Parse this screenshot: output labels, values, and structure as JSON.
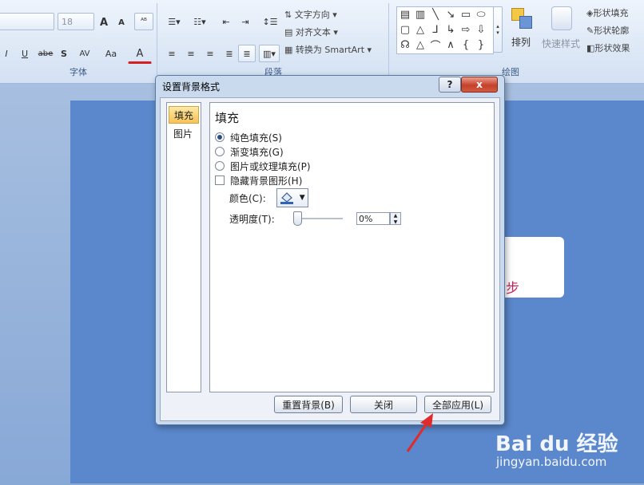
{
  "ribbon": {
    "font_size_value": "18",
    "font_group_label": "字体",
    "paragraph_group_label": "段落",
    "drawing_group_label": "绘图",
    "text_direction": "文字方向",
    "align_text": "对齐文本",
    "convert_smartart": "转换为 SmartArt",
    "arrange": "排列",
    "quick_styles": "快速样式",
    "shape_fill": "形状填充",
    "shape_outline": "形状轮廓",
    "shape_effects": "形状效果",
    "btn_grow": "A",
    "btn_shrink": "A",
    "btn_italic": "I",
    "btn_underline": "U",
    "btn_strike": "abe",
    "btn_shadow": "S",
    "btn_spacing": "AV",
    "btn_case": "Aa",
    "btn_color": "A"
  },
  "slide": {
    "visible_char": "步"
  },
  "dialog": {
    "title": "设置背景格式",
    "help_glyph": "?",
    "close_glyph": "x",
    "nav": [
      {
        "label": "填充",
        "active": true
      },
      {
        "label": "图片",
        "active": false
      }
    ],
    "panel_title": "填充",
    "options": [
      {
        "label": "纯色填充(S)",
        "type": "radio",
        "checked": true
      },
      {
        "label": "渐变填充(G)",
        "type": "radio",
        "checked": false
      },
      {
        "label": "图片或纹理填充(P)",
        "type": "radio",
        "checked": false
      },
      {
        "label": "隐藏背景图形(H)",
        "type": "checkbox",
        "checked": false
      }
    ],
    "color_label": "颜色(C):",
    "transparency_label": "透明度(T):",
    "transparency_value": "0%",
    "transparency_level": 0,
    "buttons": {
      "reset": "重置背景(B)",
      "close": "关闭",
      "apply_all": "全部应用(L)"
    }
  },
  "watermark": {
    "logo": "Bai du 经验",
    "url": "jingyan.baidu.com"
  },
  "colors": {
    "slide_bg": "#5b88cc",
    "arrow": "#e12b2b",
    "accent_text": "#c8265a"
  }
}
